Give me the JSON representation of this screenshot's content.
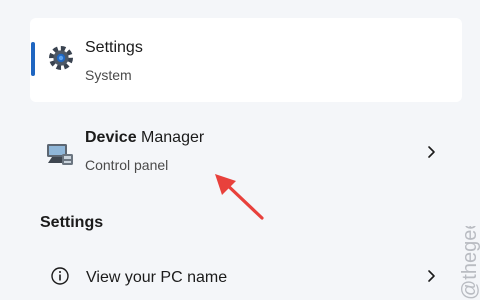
{
  "results": {
    "settings": {
      "title": "Settings",
      "subtitle": "System",
      "icon": "gear-icon"
    },
    "device_manager": {
      "title_bold": "Device",
      "title_rest": " Manager",
      "subtitle": "Control panel",
      "icon": "device-manager-icon"
    }
  },
  "section": {
    "title": "Settings"
  },
  "settings_items": [
    {
      "label": "View your PC name",
      "icon": "info-icon"
    }
  ],
  "watermark": "@thegeekpage",
  "colors": {
    "accent": "#1f66c1",
    "annotation_arrow": "#e8413c",
    "selected_card": "#ffffff",
    "background": "#f4f6f9"
  }
}
